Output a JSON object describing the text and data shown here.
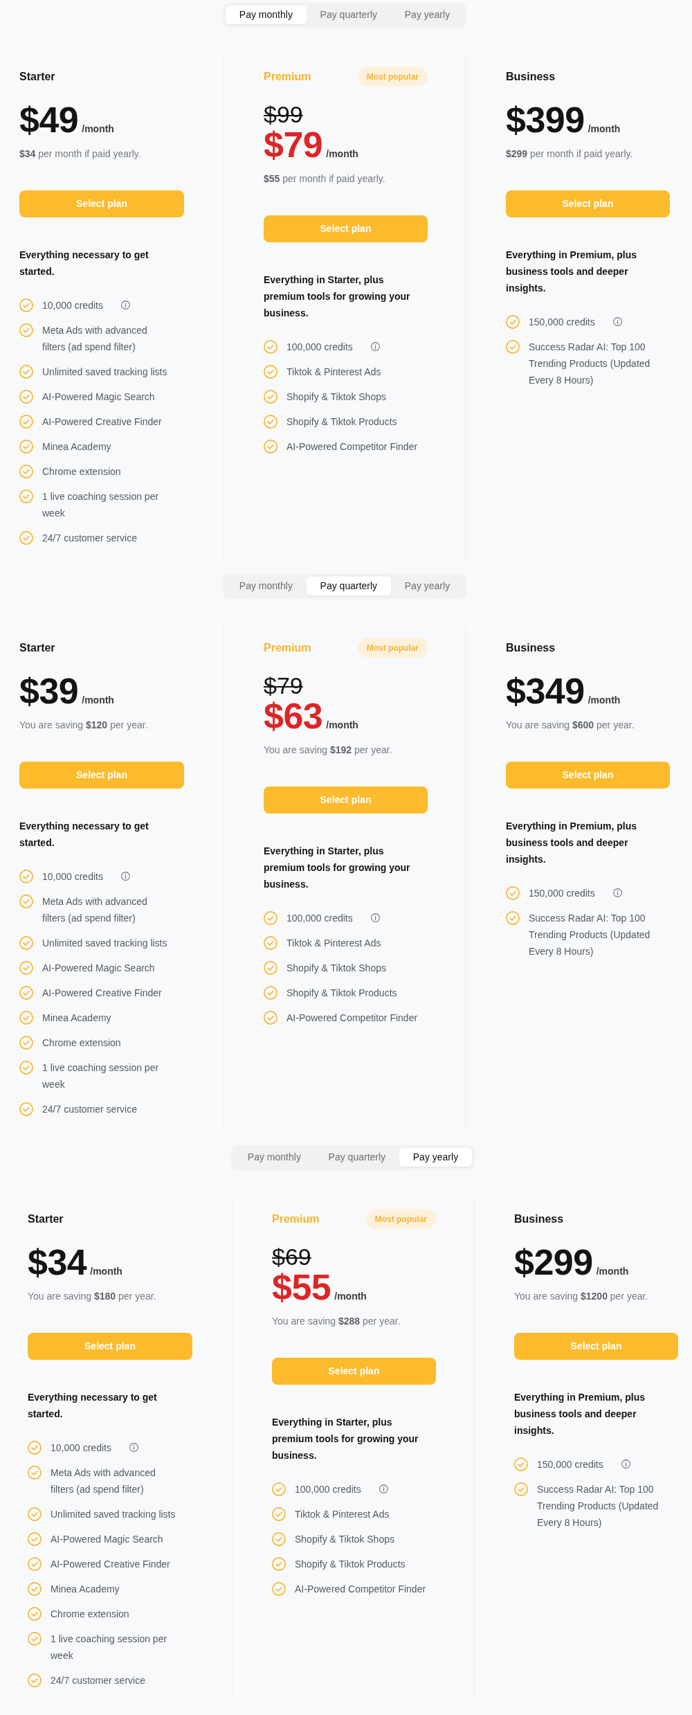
{
  "sections": [
    {
      "billing_toggle": [
        {
          "label": "Pay monthly",
          "selected": true
        },
        {
          "label": "Pay quarterly",
          "selected": false
        },
        {
          "label": "Pay yearly",
          "selected": false
        }
      ],
      "plans": [
        {
          "name": "Starter",
          "featured": false,
          "price": "$49",
          "period": "/month",
          "note": "**$34** per month if paid yearly.",
          "button": "Select plan",
          "summary": "Everything necessary to get started.",
          "features": [
            {
              "text": "10,000 credits",
              "info": true
            },
            {
              "text": "Meta Ads with advanced filters (ad spend filter)",
              "info": false
            },
            {
              "text": "Unlimited saved tracking lists",
              "info": false
            },
            {
              "text": "AI-Powered Magic Search",
              "info": false
            },
            {
              "text": "AI-Powered Creative Finder",
              "info": false
            },
            {
              "text": "Minea Academy",
              "info": false
            },
            {
              "text": "Chrome extension",
              "info": false
            },
            {
              "text": "1 live coaching session per week",
              "info": false
            },
            {
              "text": "24/7 customer service",
              "info": false
            }
          ]
        },
        {
          "name": "Premium",
          "featured": true,
          "badge": "Most popular",
          "original_price": "$99",
          "price": "$79",
          "period": "/month",
          "note": "**$55** per month if paid yearly.",
          "button": "Select plan",
          "summary": "Everything in Starter, plus premium tools for growing your business.",
          "features": [
            {
              "text": "100,000 credits",
              "info": true
            },
            {
              "text": "Tiktok & Pinterest Ads",
              "info": false
            },
            {
              "text": "Shopify & Tiktok Shops",
              "info": false
            },
            {
              "text": "Shopify & Tiktok Products",
              "info": false
            },
            {
              "text": "AI-Powered Competitor Finder",
              "info": false
            }
          ]
        },
        {
          "name": "Business",
          "featured": false,
          "price": "$399",
          "period": "/month",
          "note": "**$299** per month if paid yearly.",
          "button": "Select plan",
          "summary": "Everything in Premium, plus business tools and deeper insights.",
          "features": [
            {
              "text": "150,000 credits",
              "info": true
            },
            {
              "text": "Success Radar AI: Top 100 Trending Products (Updated Every 8 Hours)",
              "info": false
            }
          ]
        }
      ]
    },
    {
      "billing_toggle": [
        {
          "label": "Pay monthly",
          "selected": false
        },
        {
          "label": "Pay quarterly",
          "selected": true
        },
        {
          "label": "Pay yearly",
          "selected": false
        }
      ],
      "plans": [
        {
          "name": "Starter",
          "featured": false,
          "price": "$39",
          "period": "/month",
          "note": "You are saving **$120** per year.",
          "button": "Select plan",
          "summary": "Everything necessary to get started.",
          "features": [
            {
              "text": "10,000 credits",
              "info": true
            },
            {
              "text": "Meta Ads with advanced filters (ad spend filter)",
              "info": false
            },
            {
              "text": "Unlimited saved tracking lists",
              "info": false
            },
            {
              "text": "AI-Powered Magic Search",
              "info": false
            },
            {
              "text": "AI-Powered Creative Finder",
              "info": false
            },
            {
              "text": "Minea Academy",
              "info": false
            },
            {
              "text": "Chrome extension",
              "info": false
            },
            {
              "text": "1 live coaching session per week",
              "info": false
            },
            {
              "text": "24/7 customer service",
              "info": false
            }
          ]
        },
        {
          "name": "Premium",
          "featured": true,
          "badge": "Most popular",
          "original_price": "$79",
          "price": "$63",
          "period": "/month",
          "note": "You are saving **$192** per year.",
          "button": "Select plan",
          "summary": "Everything in Starter, plus premium tools for growing your business.",
          "features": [
            {
              "text": "100,000 credits",
              "info": true
            },
            {
              "text": "Tiktok & Pinterest Ads",
              "info": false
            },
            {
              "text": "Shopify & Tiktok Shops",
              "info": false
            },
            {
              "text": "Shopify & Tiktok Products",
              "info": false
            },
            {
              "text": "AI-Powered Competitor Finder",
              "info": false
            }
          ]
        },
        {
          "name": "Business",
          "featured": false,
          "price": "$349",
          "period": "/month",
          "note": "You are saving **$600** per year.",
          "button": "Select plan",
          "summary": "Everything in Premium, plus business tools and deeper insights.",
          "features": [
            {
              "text": "150,000 credits",
              "info": true
            },
            {
              "text": "Success Radar AI: Top 100 Trending Products (Updated Every 8 Hours)",
              "info": false
            }
          ]
        }
      ]
    },
    {
      "billing_toggle": [
        {
          "label": "Pay monthly",
          "selected": false
        },
        {
          "label": "Pay quarterly",
          "selected": false
        },
        {
          "label": "Pay yearly",
          "selected": true
        }
      ],
      "plans": [
        {
          "name": "Starter",
          "featured": false,
          "price": "$34",
          "period": "/month",
          "note": "You are saving **$180** per year.",
          "button": "Select plan",
          "summary": "Everything necessary to get started.",
          "features": [
            {
              "text": "10,000 credits",
              "info": true
            },
            {
              "text": "Meta Ads with advanced filters (ad spend filter)",
              "info": false
            },
            {
              "text": "Unlimited saved tracking lists",
              "info": false
            },
            {
              "text": "AI-Powered Magic Search",
              "info": false
            },
            {
              "text": "AI-Powered Creative Finder",
              "info": false
            },
            {
              "text": "Minea Academy",
              "info": false
            },
            {
              "text": "Chrome extension",
              "info": false
            },
            {
              "text": "1 live coaching session per week",
              "info": false
            },
            {
              "text": "24/7 customer service",
              "info": false
            }
          ]
        },
        {
          "name": "Premium",
          "featured": true,
          "badge": "Most popular",
          "original_price": "$69",
          "price": "$55",
          "period": "/month",
          "note": "You are saving **$288** per year.",
          "button": "Select plan",
          "summary": "Everything in Starter, plus premium tools for growing your business.",
          "features": [
            {
              "text": "100,000 credits",
              "info": true
            },
            {
              "text": "Tiktok & Pinterest Ads",
              "info": false
            },
            {
              "text": "Shopify & Tiktok Shops",
              "info": false
            },
            {
              "text": "Shopify & Tiktok Products",
              "info": false
            },
            {
              "text": "AI-Powered Competitor Finder",
              "info": false
            }
          ]
        },
        {
          "name": "Business",
          "featured": false,
          "price": "$299",
          "period": "/month",
          "note": "You are saving **$1200** per year.",
          "button": "Select plan",
          "summary": "Everything in Premium, plus business tools and deeper insights.",
          "features": [
            {
              "text": "150,000 credits",
              "info": true
            },
            {
              "text": "Success Radar AI: Top 100 Trending Products (Updated Every 8 Hours)",
              "info": false
            }
          ]
        }
      ]
    }
  ]
}
